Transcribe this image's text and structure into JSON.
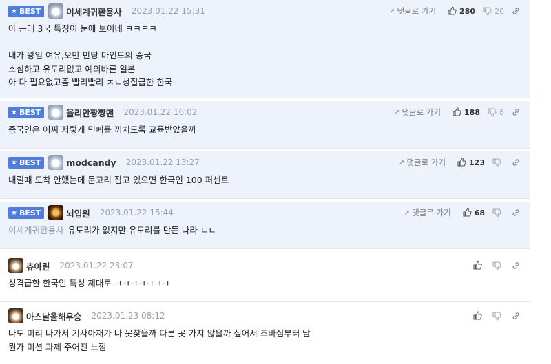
{
  "labels": {
    "best": "BEST",
    "reply_to": "댓글로 가기"
  },
  "colors": {
    "best_bg": "#eef2fb",
    "badge": "#4f7ce0"
  },
  "comments": [
    {
      "best": true,
      "nick": "이세계귀환용사",
      "date": "2023.01.22 15:31",
      "up": "280",
      "down": "20",
      "lines": [
        "아 근데 3국 특징이 눈에 보이네 ㅋㅋㅋㅋ",
        "",
        "내가 왕임 여유,오만 만땅 마인드의 중국",
        "소심하고 유도리없고 예의바른 일본",
        "아 다 필요없고좀 빨리빨리 ㅈㄴ성질급한 한국"
      ]
    },
    {
      "best": true,
      "nick": "율리안짱짱맨",
      "date": "2023.01.22 16:02",
      "up": "188",
      "down": "8",
      "lines": [
        "중국인은 어찌 저렇게 민폐를 끼치도록 교육받았을까"
      ]
    },
    {
      "best": true,
      "nick": "modcandy",
      "date": "2023.01.22 13:27",
      "up": "123",
      "down": "",
      "lines": [
        "내릴때 도착 안했는데 문고리 잡고 있으면 한국인 100 퍼센트"
      ]
    },
    {
      "best": true,
      "nick": "뇌입원",
      "date": "2023.01.22 15:44",
      "up": "68",
      "down": "",
      "mention": "이세계귀환용사",
      "lines": [
        "유도리가 없지만 유도리를 만든 나라 ㄷㄷ"
      ]
    },
    {
      "best": false,
      "nick": "츄아린",
      "date": "2023.01.22 23:07",
      "up": "",
      "down": "",
      "lines": [
        "성격급한 한국인 특성 제대로 ㅋㅋㅋㅋㅋㅋㅋ"
      ]
    },
    {
      "best": false,
      "nick": "아스날올해우승",
      "date": "2023.01.23 08:12",
      "up": "",
      "down": "",
      "lines": [
        "나도 미리 나가서 기사아재가 나 못찾을까 다른 곳 가지 않을까 싶어서 조바심부터 남",
        "뭔가 미션 과제 주어진 느낌"
      ]
    }
  ]
}
